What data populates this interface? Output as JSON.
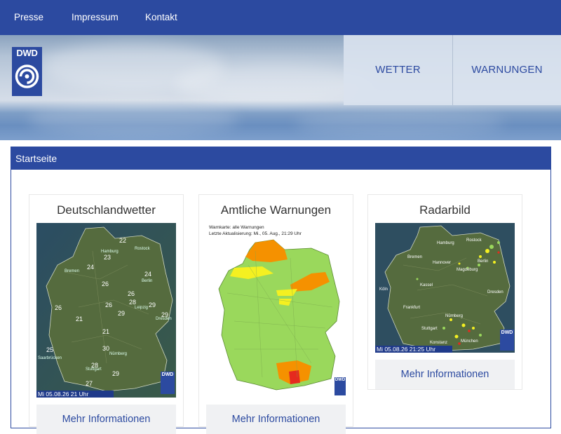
{
  "topnav": {
    "items": [
      "Presse",
      "Impressum",
      "Kontakt"
    ]
  },
  "header": {
    "logo_text": "DWD",
    "nav": [
      "WETTER",
      "WARNUNGEN"
    ]
  },
  "panel": {
    "title": "Startseite"
  },
  "cards": [
    {
      "title": "Deutschlandwetter",
      "timestamp": "Mi 05.08.26 21 Uhr",
      "logo_text": "DWD",
      "temperatures": [
        "22",
        "23",
        "24",
        "24",
        "26",
        "26",
        "26",
        "26",
        "28",
        "29",
        "29",
        "29",
        "21",
        "21",
        "25",
        "30",
        "28",
        "29",
        "27"
      ],
      "cities": [
        "Hamburg",
        "Rostock",
        "Bremen",
        "Berlin",
        "Leipzig",
        "Dresden",
        "Nürnberg",
        "Saarbrücken",
        "Stuttgart"
      ],
      "button": "Mehr Informationen"
    },
    {
      "title": "Amtliche Warnungen",
      "map_title": "Warnkarte: alle Warnungen",
      "map_updated": "Letzte Aktualisierung: Mi., 05. Aug., 21:29 Uhr",
      "logo_text": "DWD",
      "button": "Mehr Informationen"
    },
    {
      "title": "Radarbild",
      "timestamp": "Mi 05.08.26 21:25 Uhr",
      "logo_text": "DWD",
      "cities": [
        "Hamburg",
        "Rostock",
        "Bremen",
        "Hannover",
        "Berlin",
        "Magdeburg",
        "Köln",
        "Kassel",
        "Frankfurt",
        "Nürnberg",
        "Stuttgart",
        "München",
        "Konstanz",
        "Dresden"
      ],
      "button": "Mehr Informationen"
    }
  ],
  "colors": {
    "brand_blue": "#2c4aa0",
    "button_bg": "#f0f1f3",
    "warn_green": "#9ad85c",
    "warn_yellow": "#f4f021",
    "warn_orange": "#f59100",
    "warn_red": "#e52a1e"
  }
}
